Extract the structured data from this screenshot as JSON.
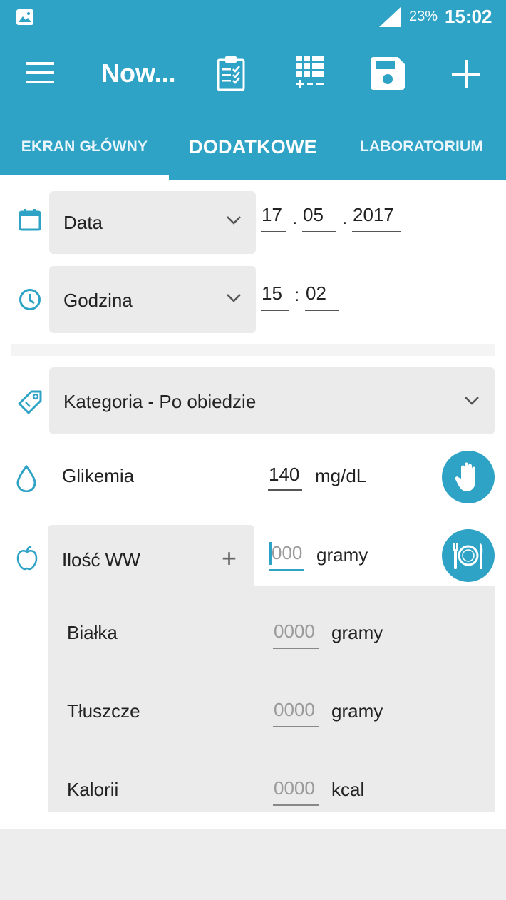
{
  "status_bar": {
    "battery": "23%",
    "time": "15:02"
  },
  "app_bar": {
    "title": "Now..."
  },
  "tabs": [
    {
      "label": "EKRAN GŁÓWNY"
    },
    {
      "label": "DODATKOWE"
    },
    {
      "label": "LABORATORIUM"
    }
  ],
  "date": {
    "label": "Data",
    "day": "17",
    "month": "05",
    "year": "2017",
    "sep1": ".",
    "sep2": "."
  },
  "time": {
    "label": "Godzina",
    "hour": "15",
    "minute": "02",
    "sep": ":"
  },
  "category": {
    "label": "Kategoria - Po obiedzie"
  },
  "glycemia": {
    "label": "Glikemia",
    "value": "140",
    "unit": "mg/dL"
  },
  "carbs": {
    "label": "Ilość WW",
    "plus": "+",
    "placeholder": "000",
    "unit": "gramy"
  },
  "nutrients": [
    {
      "label": "Białka",
      "placeholder": "0000",
      "unit": "gramy"
    },
    {
      "label": "Tłuszcze",
      "placeholder": "0000",
      "unit": "gramy"
    },
    {
      "label": "Kalorii",
      "placeholder": "0000",
      "unit": "kcal"
    }
  ],
  "colors": {
    "accent": "#2ea3c6",
    "panel": "#ebebeb"
  }
}
